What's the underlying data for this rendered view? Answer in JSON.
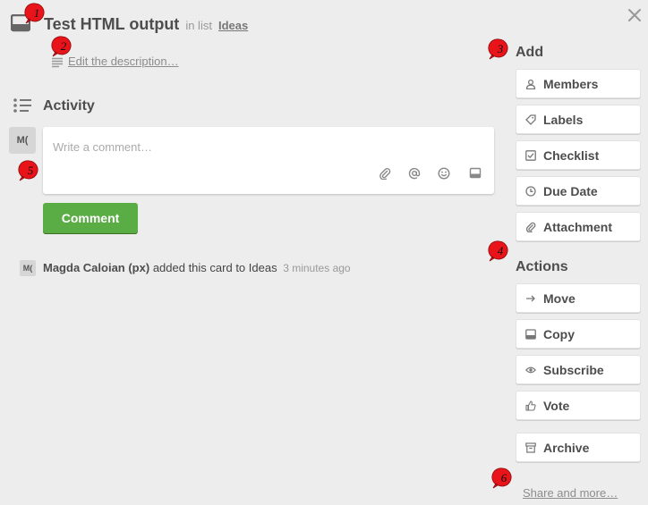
{
  "header": {
    "title": "Test HTML output",
    "in_list_text": "in list",
    "list_name": "Ideas"
  },
  "description": {
    "link_text": "Edit the description…"
  },
  "activity": {
    "title": "Activity",
    "avatar_initials": "M(",
    "comment_placeholder": "Write a comment…",
    "comment_button": "Comment",
    "entries": [
      {
        "avatar_initials": "M(",
        "user": "Magda Caloian (px)",
        "action": "added this card to Ideas",
        "time": "3 minutes ago"
      }
    ]
  },
  "sidebar": {
    "add_title": "Add",
    "add_buttons": [
      "Members",
      "Labels",
      "Checklist",
      "Due Date",
      "Attachment"
    ],
    "actions_title": "Actions",
    "action_buttons": [
      "Move",
      "Copy",
      "Subscribe",
      "Vote"
    ],
    "archive_button": "Archive",
    "share_link": "Share and more…"
  },
  "annotations": [
    "1",
    "2",
    "3",
    "4",
    "5",
    "6"
  ],
  "colors": {
    "background": "#ededed",
    "comment_button": "#5aac44",
    "annotation_marker": "#e8141a"
  }
}
